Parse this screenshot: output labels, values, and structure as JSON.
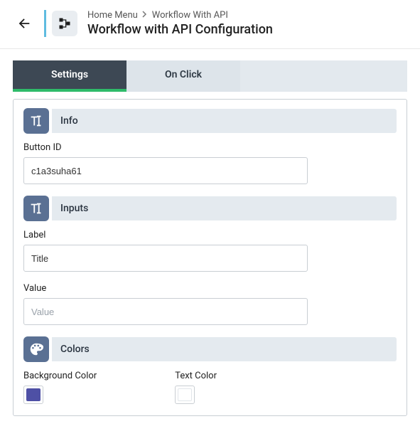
{
  "breadcrumbs": {
    "home": "Home Menu",
    "current": "Workflow With API"
  },
  "page_title": "Workflow with API Configuration",
  "tabs": {
    "settings": "Settings",
    "on_click": "On Click"
  },
  "sections": {
    "info": {
      "title": "Info"
    },
    "inputs": {
      "title": "Inputs"
    },
    "colors": {
      "title": "Colors"
    }
  },
  "fields": {
    "button_id": {
      "label": "Button ID",
      "value": "c1a3suha61"
    },
    "label": {
      "label": "Label",
      "value": "Title"
    },
    "value": {
      "label": "Value",
      "value": "",
      "placeholder": "Value"
    },
    "bg_color": {
      "label": "Background Color",
      "value": "#4e50a5"
    },
    "text_color": {
      "label": "Text Color",
      "value": "#ffffff"
    }
  }
}
